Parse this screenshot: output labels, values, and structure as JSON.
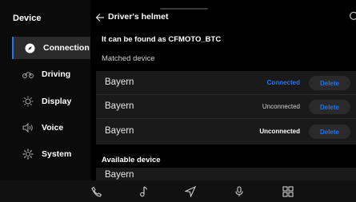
{
  "sidebar": {
    "title": "Device",
    "items": [
      {
        "label": "Connection",
        "icon": "compass-icon"
      },
      {
        "label": "Driving",
        "icon": "motorcycle-icon"
      },
      {
        "label": "Display",
        "icon": "brightness-icon"
      },
      {
        "label": "Voice",
        "icon": "speaker-icon"
      },
      {
        "label": "System",
        "icon": "gear-icon"
      }
    ],
    "active_index": 0
  },
  "header": {
    "title": "Driver's helmet"
  },
  "hint": "It can be found as CFMOTO_BTC",
  "matched": {
    "title": "Matched device",
    "devices": [
      {
        "name": "Bayern",
        "status": "Connected",
        "button": "Delete"
      },
      {
        "name": "Bayern",
        "status": "Unconnected",
        "button": "Delete"
      },
      {
        "name": "Bayern",
        "status": "Unconnected",
        "button": "Delete"
      }
    ]
  },
  "available": {
    "title": "Available device",
    "devices": [
      {
        "name": "Bayern"
      }
    ]
  },
  "colors": {
    "accent": "#1e74f5",
    "background": "#000000",
    "panel": "#1a1a1a"
  },
  "bottom_nav": [
    "phone-icon",
    "music-icon",
    "navigation-icon",
    "microphone-icon",
    "apps-grid-icon"
  ]
}
